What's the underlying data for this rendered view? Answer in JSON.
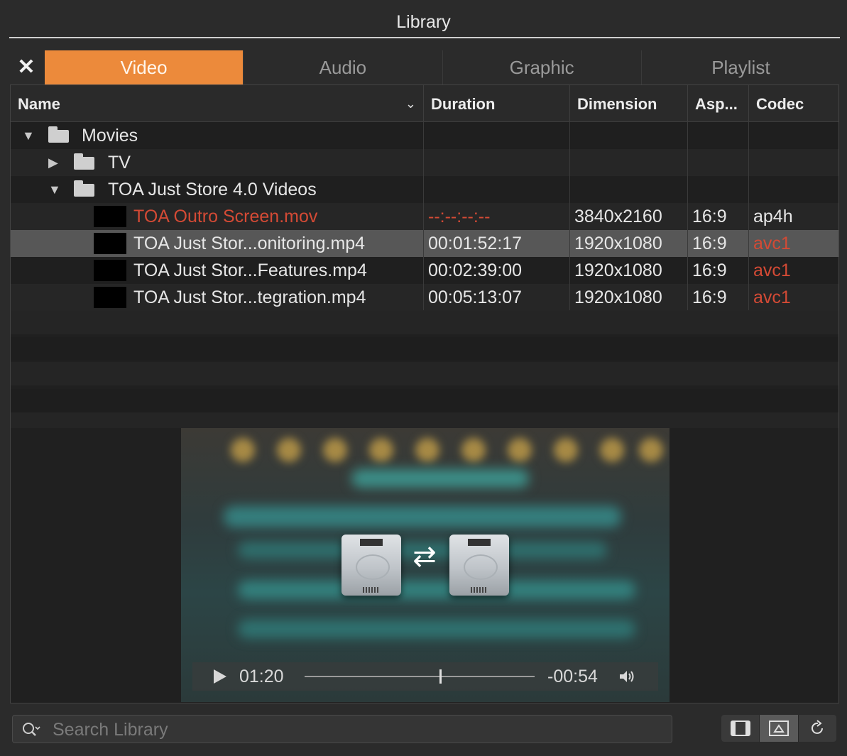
{
  "window": {
    "title": "Library"
  },
  "close_label": "✕",
  "tabs": [
    {
      "label": "Video",
      "active": true
    },
    {
      "label": "Audio",
      "active": false
    },
    {
      "label": "Graphic",
      "active": false
    },
    {
      "label": "Playlist",
      "active": false
    }
  ],
  "table": {
    "headers": {
      "name": "Name",
      "sort_icon": "chevron-down-icon",
      "duration": "Duration",
      "dimension": "Dimension",
      "aspect": "Asp...",
      "codec": "Codec"
    },
    "tree": {
      "movies": {
        "label": "Movies",
        "expanded": true,
        "icon": "folder-icon"
      },
      "tv": {
        "label": "TV",
        "expanded": false,
        "icon": "folder-icon"
      },
      "toa": {
        "label": "TOA Just Store 4.0 Videos",
        "expanded": true,
        "icon": "folder-icon"
      }
    },
    "files": [
      {
        "name": "TOA Outro Screen.mov",
        "duration": "--:--:--:--",
        "dimension": "3840x2160",
        "aspect": "16:9",
        "codec": "ap4h",
        "missing": true,
        "selected": false
      },
      {
        "name": "TOA Just Stor...onitoring.mp4",
        "duration": "00:01:52:17",
        "dimension": "1920x1080",
        "aspect": "16:9",
        "codec": "avc1",
        "missing": false,
        "selected": true
      },
      {
        "name": "TOA Just Stor...Features.mp4",
        "duration": "00:02:39:00",
        "dimension": "1920x1080",
        "aspect": "16:9",
        "codec": "avc1",
        "missing": false,
        "selected": false
      },
      {
        "name": "TOA Just Stor...tegration.mp4",
        "duration": "00:05:13:07",
        "dimension": "1920x1080",
        "aspect": "16:9",
        "codec": "avc1",
        "missing": false,
        "selected": false
      }
    ]
  },
  "preview": {
    "current_time": "01:20",
    "remaining_time": "-00:54",
    "progress": 0.6,
    "overlay_icon": "drive-swap-icon"
  },
  "search": {
    "placeholder": "Search Library",
    "value": ""
  },
  "view_buttons": [
    {
      "icon": "filmstrip-icon",
      "active": false
    },
    {
      "icon": "image-preview-icon",
      "active": true
    },
    {
      "icon": "refresh-icon",
      "active": false
    }
  ],
  "colors": {
    "accent": "#ec8a3b",
    "missing_text": "#d44a35",
    "background": "#2b2b2b"
  }
}
